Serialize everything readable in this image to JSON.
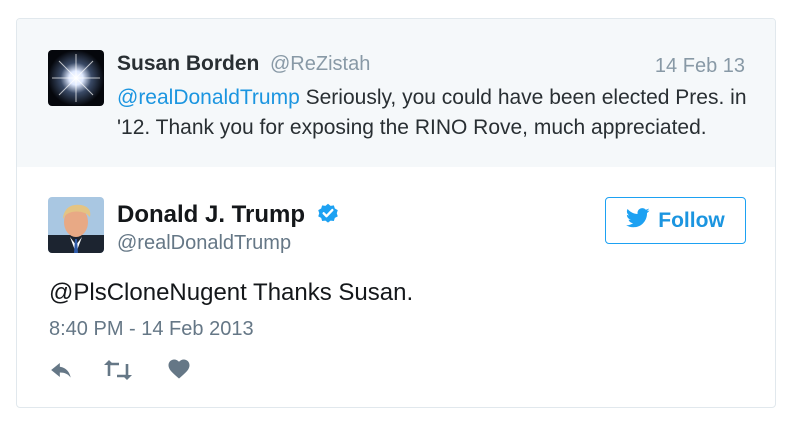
{
  "reply_context": {
    "name": "Susan Borden",
    "handle": "@ReZistah",
    "date": "14 Feb 13",
    "mention": "@realDonaldTrump",
    "text": " Seriously, you could have been elected Pres. in '12. Thank you for exposing the RINO Rove, much appreciated."
  },
  "tweet": {
    "author_name": "Donald J. Trump",
    "author_handle": "@realDonaldTrump",
    "verified": true,
    "follow_label": "Follow",
    "text": "@PlsCloneNugent Thanks Susan.",
    "timestamp": "8:40 PM - 14 Feb 2013"
  },
  "icons": {
    "verified": "verified-badge-icon",
    "follow": "twitter-bird-icon",
    "reply": "reply-icon",
    "retweet": "retweet-icon",
    "like": "heart-icon"
  },
  "colors": {
    "accent": "#1da1f2",
    "link": "#1b95e0",
    "muted": "#8899a6",
    "context_bg": "#f5f8fa"
  }
}
